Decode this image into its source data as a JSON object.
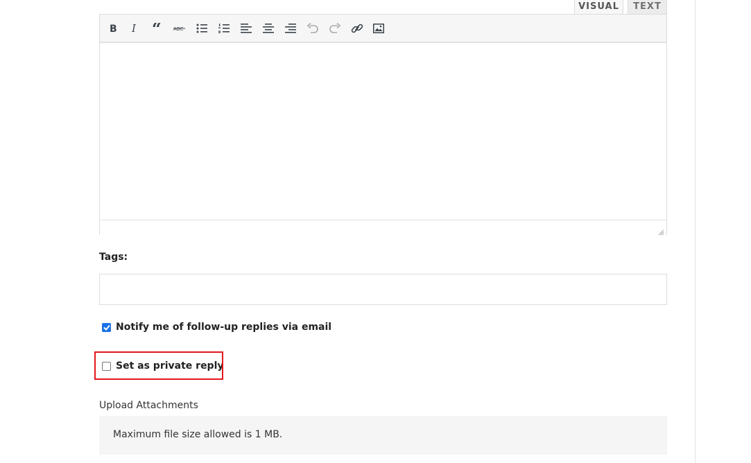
{
  "editor": {
    "tabs": {
      "visual": "VISUAL",
      "text": "TEXT"
    },
    "toolbar": [
      "bold-icon",
      "italic-icon",
      "blockquote-icon",
      "strikethrough-icon",
      "bulleted-list-icon",
      "numbered-list-icon",
      "align-left-icon",
      "align-center-icon",
      "align-right-icon",
      "undo-icon",
      "redo-icon",
      "link-icon",
      "image-icon"
    ],
    "strike_glyph": "ABC"
  },
  "tags": {
    "label": "Tags:",
    "value": ""
  },
  "notify": {
    "label": "Notify me of follow-up replies via email",
    "checked": true
  },
  "private_reply": {
    "label": "Set as private reply",
    "checked": false,
    "highlight_color": "#e3151a"
  },
  "upload": {
    "label": "Upload Attachments",
    "note": "Maximum file size allowed is 1 MB."
  }
}
